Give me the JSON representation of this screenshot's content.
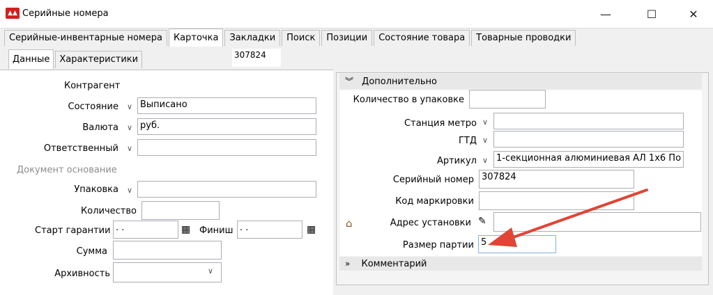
{
  "window": {
    "title": "Серийные номера",
    "controls": {
      "minimize": "—",
      "maximize": "☐",
      "close": "✕"
    }
  },
  "main_tabs": [
    {
      "label": "Серийные-инвентарные номера"
    },
    {
      "label": "Карточка",
      "active": true
    },
    {
      "label": "Закладки"
    },
    {
      "label": "Поиск"
    },
    {
      "label": "Позиции"
    },
    {
      "label": "Состояние товара"
    },
    {
      "label": "Товарные проводки"
    }
  ],
  "sub_tabs": [
    {
      "label": "Данные",
      "active": true
    },
    {
      "label": "Характеристики"
    }
  ],
  "record_id": "307824",
  "left_form": {
    "kontragent": {
      "label": "Контрагент"
    },
    "sostoyanie": {
      "label": "Состояние",
      "value": "Выписано"
    },
    "valyuta": {
      "label": "Валюта",
      "value": "руб."
    },
    "otvetstvenny": {
      "label": "Ответственный",
      "value": ""
    },
    "dokument_osnovanie": {
      "label": "Документ основание"
    },
    "upakovka": {
      "label": "Упаковка",
      "value": ""
    },
    "kolichestvo": {
      "label": "Количество",
      "value": ""
    },
    "start_garantii": {
      "label": "Старт гарантии",
      "value": ".  ."
    },
    "finish": {
      "label": "Финиш",
      "value": ".  ."
    },
    "summa": {
      "label": "Сумма",
      "value": ""
    },
    "arkhivnost": {
      "label": "Архивность",
      "value": ""
    }
  },
  "right_panel": {
    "section_additional": "Дополнительно",
    "kolvo_v_upakovke": {
      "label": "Количество в упаковке",
      "value": ""
    },
    "stanciya_metro": {
      "label": "Станция метро",
      "value": ""
    },
    "gtd": {
      "label": "ГТД",
      "value": ""
    },
    "artikul": {
      "label": "Артикул",
      "value": "1-секционная алюминиевая АЛ 1х6 По"
    },
    "seriyny_nomer": {
      "label": "Серийный номер",
      "value": "307824"
    },
    "kod_markirovki": {
      "label": "Код маркировки",
      "value": ""
    },
    "adres_ustanovki": {
      "label": "Адрес установки",
      "value": ""
    },
    "razmer_partii": {
      "label": "Размер партии",
      "value": "5"
    },
    "section_comment": "Комментарий"
  },
  "colors": {
    "annotation_arrow": "#e04535",
    "app_icon": "#d12020"
  }
}
